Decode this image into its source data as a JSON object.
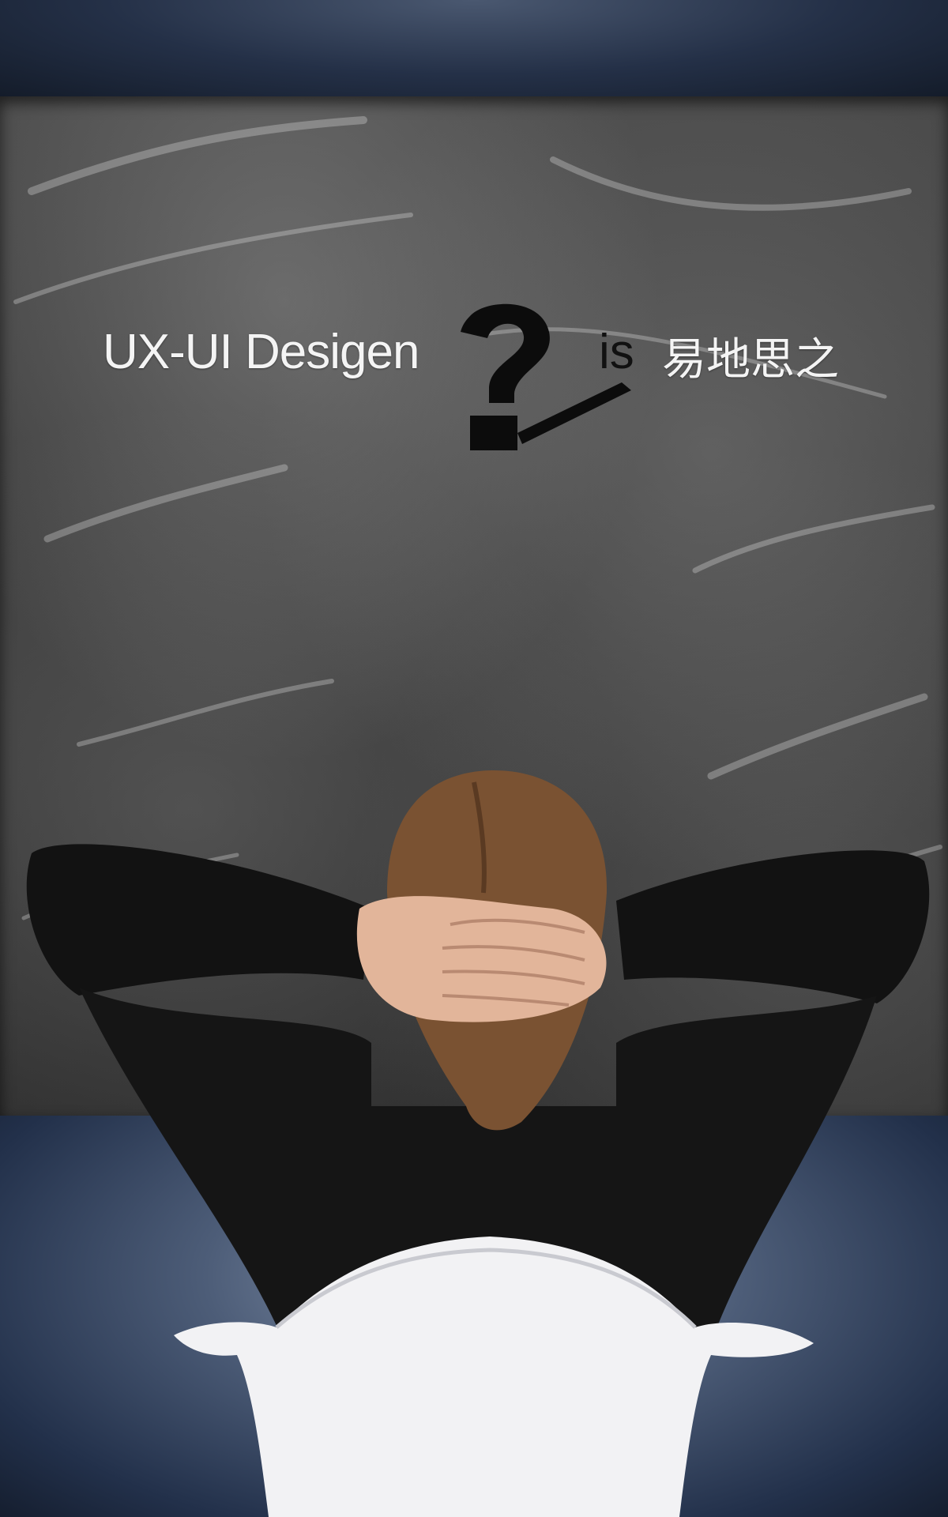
{
  "headline": {
    "lead": "UX-UI Desigen",
    "connector": "is",
    "tail": "易地思之"
  },
  "icons": {
    "question_mark": "question-mark-icon"
  },
  "colors": {
    "wall": "#243047",
    "chalkboard": "#3c3c3c",
    "headline_text": "#f4f4f4",
    "connector_text": "#111111",
    "sweater": "#121212",
    "hair": "#7a5232",
    "skin": "#e2b59a",
    "chair": "#f2f2f4"
  }
}
